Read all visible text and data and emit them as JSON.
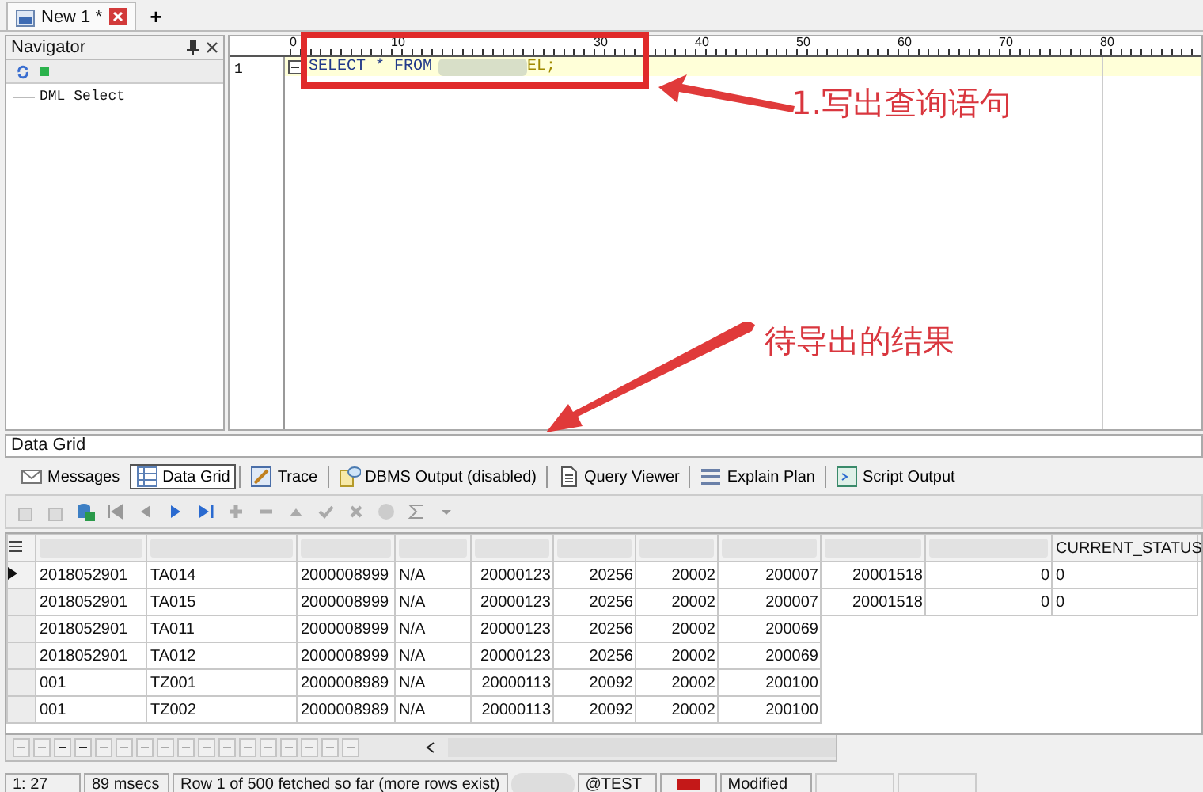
{
  "doc_tabs": [
    {
      "label": "New 1 *",
      "selected": true
    }
  ],
  "new_tab_button": "+",
  "navigator": {
    "title": "Navigator",
    "items": [
      {
        "label": "DML Select"
      }
    ]
  },
  "editor": {
    "ruler_labels": [
      {
        "kind": "number",
        "text": "0"
      },
      {
        "kind": "number",
        "text": "10"
      },
      {
        "kind": "blank"
      },
      {
        "kind": "number",
        "text": "30"
      },
      {
        "kind": "number",
        "text": "40"
      },
      {
        "kind": "number",
        "text": "50"
      },
      {
        "kind": "number",
        "text": "60"
      },
      {
        "kind": "number",
        "text": "70"
      },
      {
        "kind": "number",
        "text": "80"
      }
    ],
    "line_number": "1",
    "code_before": "SELECT * FROM",
    "code_after": "EL;"
  },
  "annotations": [
    {
      "kind": "box_arrow",
      "text": "1.写出查询语句"
    },
    {
      "kind": "arrow",
      "text": "待导出的结果"
    }
  ],
  "panel_title": "Data Grid",
  "result_tabs": [
    {
      "label": "Messages",
      "selected": false
    },
    {
      "label": "Data Grid",
      "selected": true
    },
    {
      "label": "Trace",
      "selected": false
    },
    {
      "label": "DBMS Output (disabled)",
      "selected": false
    },
    {
      "label": "Query Viewer",
      "selected": false
    },
    {
      "label": "Explain Plan",
      "selected": false
    },
    {
      "label": "Script Output",
      "selected": false
    }
  ],
  "grid": {
    "header_label": "CURRENT_STATUS",
    "rows": [
      {
        "selected": true,
        "cells": [
          "2018052901",
          "TA014",
          "2000008999",
          "N/A",
          "20000123",
          "20256",
          "20002",
          "200007",
          "20001518",
          "0",
          "0"
        ]
      },
      {
        "selected": false,
        "cells": [
          "2018052901",
          "TA015",
          "2000008999",
          "N/A",
          "20000123",
          "20256",
          "20002",
          "200007",
          "20001518",
          "0",
          "0"
        ]
      },
      {
        "selected": false,
        "cells": [
          "2018052901",
          "TA011",
          "2000008999",
          "N/A",
          "20000123",
          "20256",
          "20002",
          "200069"
        ]
      },
      {
        "selected": false,
        "cells": [
          "2018052901",
          "TA012",
          "2000008999",
          "N/A",
          "20000123",
          "20256",
          "20002",
          "200069"
        ]
      },
      {
        "selected": false,
        "cells": [
          "001",
          "TZ001",
          "2000008989",
          "N/A",
          "20000113",
          "20092",
          "20002",
          "200100"
        ]
      },
      {
        "selected": false,
        "cells": [
          "001",
          "TZ002",
          "2000008989",
          "N/A",
          "20000113",
          "20092",
          "20002",
          "200100"
        ]
      }
    ]
  },
  "status_bar": {
    "position": "1: 27",
    "time": "89 msecs",
    "message": "Row 1 of 500 fetched so far (more rows exist)",
    "connection": "@TEST",
    "state": "Modified"
  }
}
